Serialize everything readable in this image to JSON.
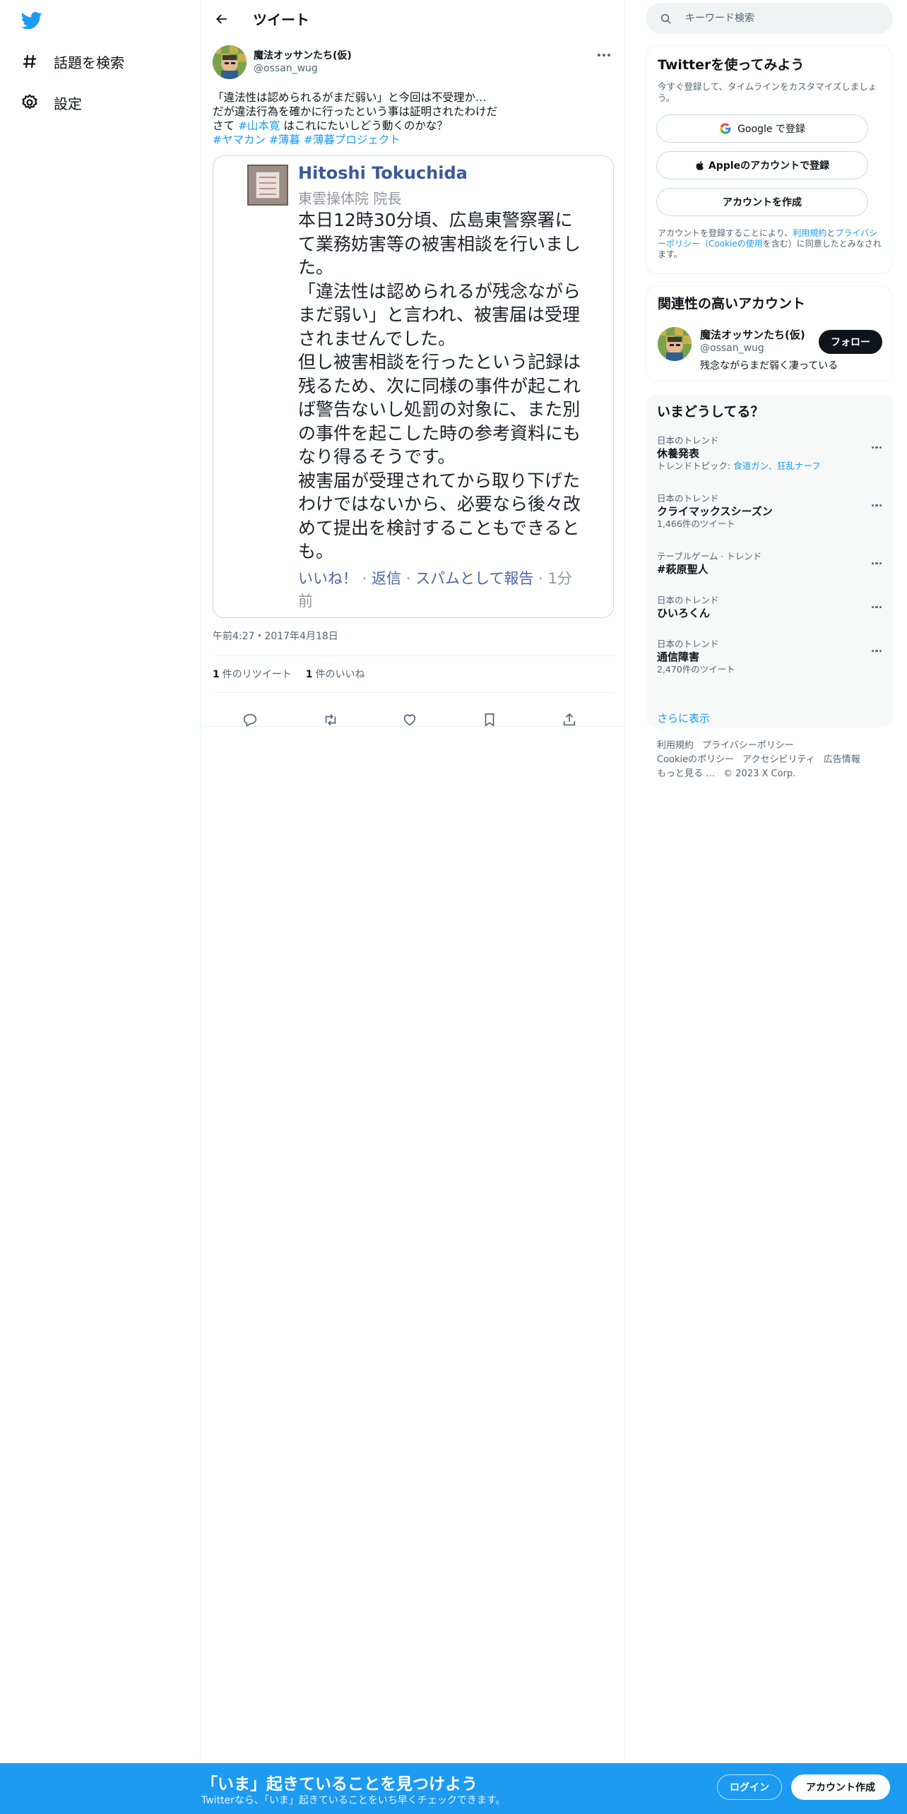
{
  "colors": {
    "accent": "#1d9bf0",
    "text": "#0f1419",
    "muted": "#536471",
    "fb_blue": "#3b5998"
  },
  "nav": {
    "logo_icon": "twitter-bird-icon",
    "items": [
      {
        "label": "話題を検索",
        "icon": "hashtag-icon"
      },
      {
        "label": "設定",
        "icon": "gear-icon"
      }
    ]
  },
  "header": {
    "title": "ツイート",
    "back_icon": "arrow-left-icon"
  },
  "tweet": {
    "author_name": "魔法オッサンたち(仮)",
    "author_handle": "@ossan_wug",
    "text_line1": "「違法性は認められるがまだ弱い」と今回は不受理か…",
    "text_line2": "だが違法行為を確かに行ったという事は証明されたわけだ",
    "text_line3_pre": "さて ",
    "text_line3_tag": "#山本寛",
    "text_line3_post": " はこれにたいしどう動くのかな？",
    "hashtags": [
      "#ヤマカン",
      "#薄暮",
      "#薄暮プロジェクト"
    ],
    "timestamp": "午前4:27・2017年4月18日",
    "retweet_count": "1",
    "retweet_label": "件のリツイート",
    "like_count": "1",
    "like_label": "件のいいね"
  },
  "embedded_post": {
    "name": "Hitoshi Tokuchida",
    "subtitle": "東雲操体院 院長",
    "body_lines": [
      "本日12時30分頃、広島東警察署に",
      "て業務妨害等の被害相談を行いまし",
      "た。",
      "「違法性は認められるが残念ながら",
      "まだ弱い」と言われ、被害届は受理",
      "されませんでした。",
      "但し被害相談を行ったという記録は",
      "残るため、次に同様の事件が起これ",
      "ば警告ないし処罰の対象に、また別",
      "の事件を起こした時の参考資料にも",
      "なり得るそうです。",
      "被害届が受理されてから取り下げた",
      "わけではないから、必要なら後々改",
      "めて提出を検討することもできると",
      "も。"
    ],
    "action_like": "いいね！",
    "action_reply": "返信",
    "action_spam": "スパムとして報告",
    "time_line1": "1分",
    "time_line2": "前"
  },
  "search": {
    "placeholder": "キーワード検索"
  },
  "signup_card": {
    "title": "Twitterを使ってみよう",
    "subtitle": "今すぐ登録して、タイムラインをカスタマイズしましょう。",
    "google_button": "Google で登録",
    "apple_button": "Appleのアカウントで登録",
    "create_button": "アカウントを作成",
    "legal_pre": "アカウントを登録することにより、",
    "legal_terms": "利用規約",
    "legal_and": "と",
    "legal_privacy": "プライバシーポリシー",
    "legal_cookie": "（Cookieの使用",
    "legal_post": "を含む）に同意したとみなされます。"
  },
  "related": {
    "title": "関連性の高いアカウント",
    "name": "魔法オッサンたち(仮)",
    "handle": "@ossan_wug",
    "bio": "残念ながらまだ弱く凄っている",
    "follow_label": "フォロー"
  },
  "trends": {
    "title": "いまどうしてる？",
    "items": [
      {
        "context": "日本のトレンド",
        "name": "休養発表",
        "meta_pre": "トレンドトピック: ",
        "meta_links": "食道ガン、狂乱ナーフ"
      },
      {
        "context": "日本のトレンド",
        "name": "クライマックスシーズン",
        "meta": "1,466件のツイート"
      },
      {
        "context": "テーブルゲーム · トレンド",
        "name": "#萩原聖人",
        "meta": ""
      },
      {
        "context": "日本のトレンド",
        "name": "ひいろくん",
        "meta": ""
      },
      {
        "context": "日本のトレンド",
        "name": "通信障害",
        "meta": "2,470件のツイート"
      }
    ],
    "show_more": "さらに表示"
  },
  "footer": {
    "links": [
      "利用規約",
      "プライバシーポリシー",
      "Cookieのポリシー",
      "アクセシビリティ",
      "広告情報",
      "もっと見る …",
      "© 2023 X Corp."
    ]
  },
  "bottom_bar": {
    "title": "「いま」起きていることを見つけよう",
    "subtitle": "Twitterなら、「いま」起きていることをいち早くチェックできます。",
    "login": "ログイン",
    "signup": "アカウント作成"
  }
}
